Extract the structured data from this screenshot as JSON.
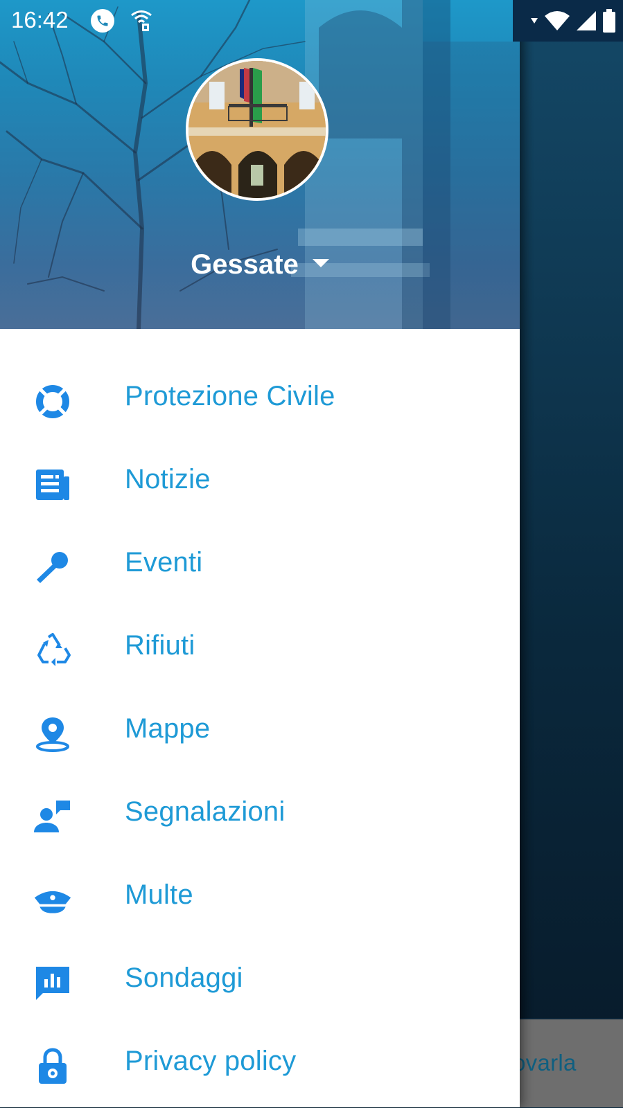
{
  "status_bar": {
    "time": "16:42"
  },
  "drawer": {
    "town_name": "Gessate",
    "menu": [
      {
        "label": "Protezione Civile",
        "icon": "lifebuoy-icon"
      },
      {
        "label": "Notizie",
        "icon": "newspaper-icon"
      },
      {
        "label": "Eventi",
        "icon": "microphone-icon"
      },
      {
        "label": "Rifiuti",
        "icon": "recycle-icon"
      },
      {
        "label": "Mappe",
        "icon": "map-pin-icon"
      },
      {
        "label": "Segnalazioni",
        "icon": "report-person-icon"
      },
      {
        "label": "Multe",
        "icon": "police-cap-icon"
      },
      {
        "label": "Sondaggi",
        "icon": "poll-chart-icon"
      },
      {
        "label": "Privacy policy",
        "icon": "lock-icon"
      }
    ]
  },
  "background": {
    "snippet": "ovarla"
  },
  "colors": {
    "accent": "#1e9ad6",
    "header": "#1f88b8"
  }
}
